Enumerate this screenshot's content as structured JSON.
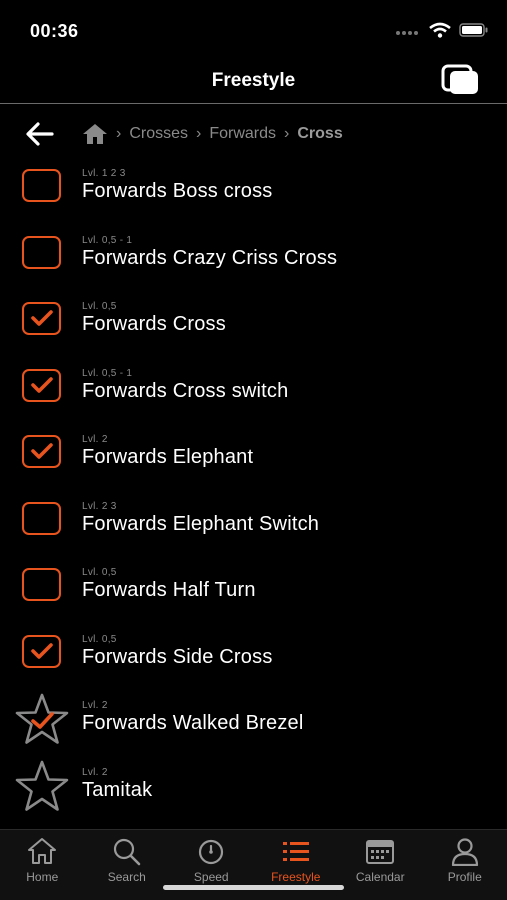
{
  "status_bar": {
    "time": "00:36"
  },
  "nav": {
    "title": "Freestyle",
    "action_icon": "copy-layers-icon"
  },
  "breadcrumb": {
    "home_icon": "home-icon",
    "items": [
      "Crosses",
      "Forwards"
    ],
    "current": "Cross"
  },
  "items": [
    {
      "level": "Lvl. 1 2 3",
      "name": "Forwards Boss cross",
      "state": "unchecked"
    },
    {
      "level": "Lvl. 0,5 - 1",
      "name": "Forwards Crazy Criss Cross",
      "state": "unchecked"
    },
    {
      "level": "Lvl. 0,5",
      "name": "Forwards Cross",
      "state": "checked"
    },
    {
      "level": "Lvl. 0,5 - 1",
      "name": "Forwards Cross switch",
      "state": "checked"
    },
    {
      "level": "Lvl. 2",
      "name": "Forwards Elephant",
      "state": "checked"
    },
    {
      "level": "Lvl. 2 3",
      "name": "Forwards Elephant Switch",
      "state": "unchecked"
    },
    {
      "level": "Lvl. 0,5",
      "name": "Forwards Half Turn",
      "state": "unchecked"
    },
    {
      "level": "Lvl. 0,5",
      "name": "Forwards Side Cross",
      "state": "checked"
    },
    {
      "level": "Lvl. 2",
      "name": "Forwards Walked Brezel",
      "state": "star-checked"
    },
    {
      "level": "Lvl. 2",
      "name": "Tamitak",
      "state": "star"
    }
  ],
  "tabs": [
    {
      "label": "Home",
      "icon": "home-icon",
      "active": false
    },
    {
      "label": "Search",
      "icon": "search-icon",
      "active": false
    },
    {
      "label": "Speed",
      "icon": "stopwatch-icon",
      "active": false
    },
    {
      "label": "Freestyle",
      "icon": "list-icon",
      "active": true
    },
    {
      "label": "Calendar",
      "icon": "calendar-icon",
      "active": false
    },
    {
      "label": "Profile",
      "icon": "person-icon",
      "active": false
    }
  ],
  "colors": {
    "accent": "#e8541e",
    "background": "#000000",
    "muted": "#8a8a8a"
  }
}
